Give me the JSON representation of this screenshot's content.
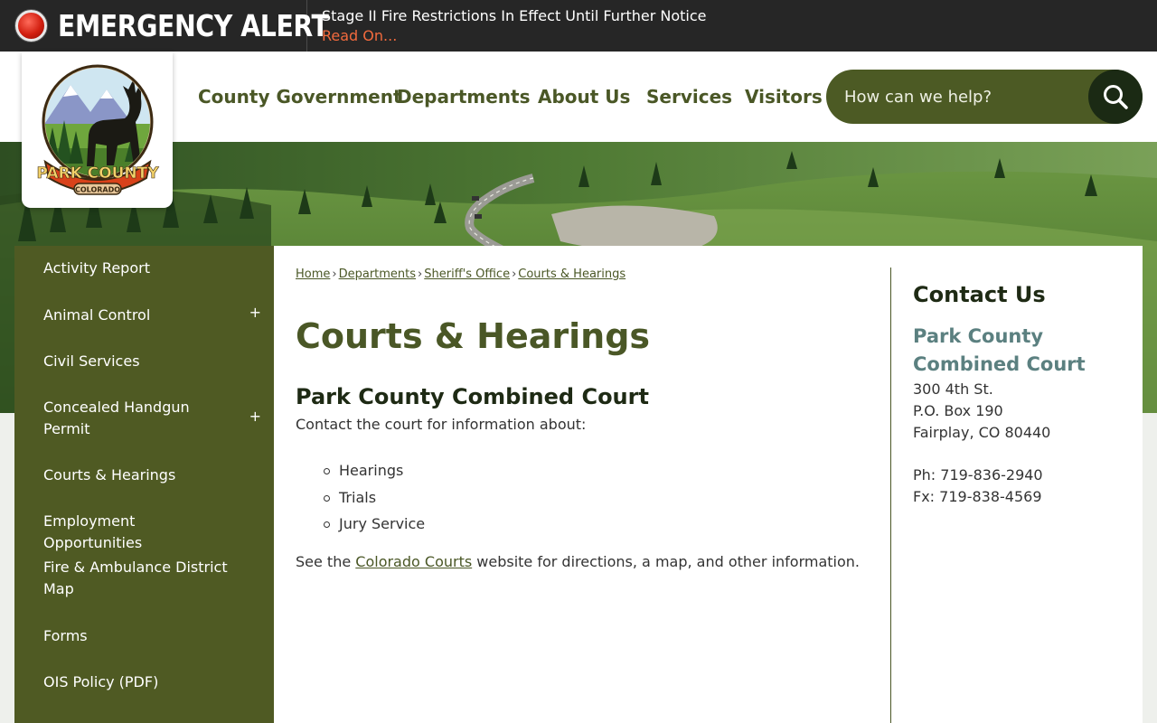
{
  "alert": {
    "title": "EMERGENCY ALERT",
    "message": "Stage II Fire Restrictions In Effect Until Further Notice",
    "link": "Read On..."
  },
  "logo": {
    "name": "PARK COUNTY",
    "state": "COLORADO"
  },
  "nav": {
    "items": [
      "County Government",
      "Departments",
      "About Us",
      "Services",
      "Visitors"
    ]
  },
  "search": {
    "placeholder": "How can we help?"
  },
  "sidebar": {
    "items": [
      {
        "label": "Activity Report",
        "expandable": false
      },
      {
        "label": "Animal Control",
        "expandable": true
      },
      {
        "label": "Civil Services",
        "expandable": false
      },
      {
        "label": "Concealed Handgun Permit",
        "expandable": true
      },
      {
        "label": "Courts & Hearings",
        "expandable": false
      },
      {
        "label": "Employment Opportunities",
        "expandable": false
      },
      {
        "label": "Fire & Ambulance District Map",
        "expandable": false
      },
      {
        "label": "Forms",
        "expandable": false
      },
      {
        "label": "OIS Policy (PDF)",
        "expandable": false
      }
    ],
    "expand_symbol": "+"
  },
  "breadcrumb": {
    "items": [
      "Home",
      "Departments",
      "Sheriff's Office",
      "Courts & Hearings"
    ],
    "separator": "›"
  },
  "main": {
    "page_title": "Courts & Hearings",
    "section_title": "Park County Combined Court",
    "intro": "Contact the court for information about:",
    "bullets": [
      "Hearings",
      "Trials",
      "Jury Service"
    ],
    "see_prefix": "See the ",
    "see_link": "Colorado Courts",
    "see_suffix": " website for directions, a map, and other information."
  },
  "contact": {
    "title": "Contact Us",
    "name": "Park County Combined Court",
    "address": [
      "300 4th St.",
      "P.O. Box 190",
      "Fairplay, CO 80440"
    ],
    "phone": "Ph: 719-836-2940",
    "fax": "Fx: 719-838-4569"
  },
  "colors": {
    "brand_green": "#4f5a23",
    "alert_bg": "#262626",
    "alert_link": "#f26a3d",
    "contact_name": "#5b8080"
  }
}
